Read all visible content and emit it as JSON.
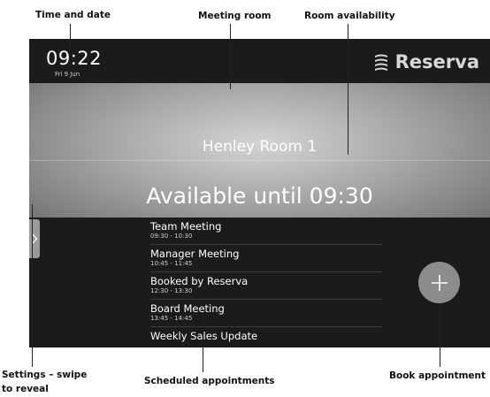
{
  "annotations": {
    "time_and_date": "Time and date",
    "meeting_room": "Meeting room",
    "room_availability": "Room availability",
    "settings_line1": "Settings – swipe",
    "settings_line2": "to reveal",
    "scheduled_appointments": "Scheduled appointments",
    "book_appointment": "Book appointment"
  },
  "header": {
    "time": "09:22",
    "date": "Fri 9 Jun",
    "brand": "Reserva",
    "brand_icon": "stack-icon"
  },
  "room": {
    "name": "Henley Room 1",
    "availability": "Available until 09:30"
  },
  "settings_tab": {
    "icon": "chevron-right-icon"
  },
  "appointments": [
    {
      "title": "Team Meeting",
      "time": "09:30 - 10:30"
    },
    {
      "title": "Manager Meeting",
      "time": "10:45 - 11:45"
    },
    {
      "title": "Booked by Reserva",
      "time": "12:30 - 13:30"
    },
    {
      "title": "Board Meeting",
      "time": "13:45 - 14:45"
    },
    {
      "title": "Weekly Sales Update",
      "time": ""
    }
  ],
  "book_button": {
    "icon": "plus-icon"
  },
  "colors": {
    "screen_bg": "#1b1b1b",
    "hero_center": "#d4d4d4",
    "hero_edge": "#6e6e6e",
    "button": "#8c8c8c"
  }
}
